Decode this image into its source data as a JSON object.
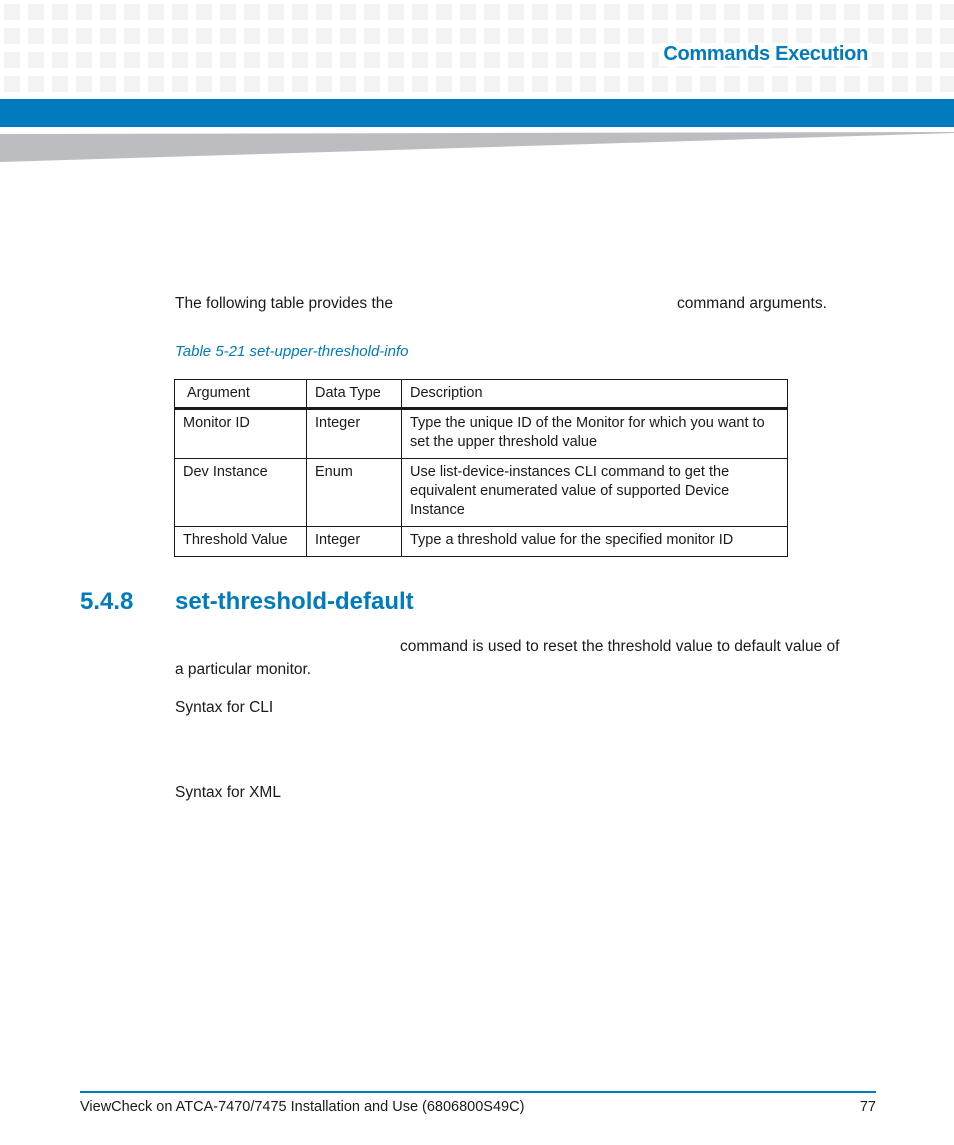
{
  "header": {
    "title": "Commands Execution",
    "accent_color": "#007bbd"
  },
  "intro": {
    "text_before": "The following table provides the",
    "text_after": "command arguments."
  },
  "table": {
    "caption": "Table 5-21 set-upper-threshold-info",
    "columns": [
      "Argument",
      "Data Type",
      "Description"
    ],
    "rows": [
      {
        "argument": "Monitor ID",
        "data_type": "Integer",
        "description": "Type the unique ID of the Monitor for which you want to set the upper threshold value"
      },
      {
        "argument": "Dev Instance",
        "data_type": "Enum",
        "description": "Use list-device-instances CLI command to get the equivalent enumerated value of supported Device Instance"
      },
      {
        "argument": "Threshold Value",
        "data_type": "Integer",
        "description": "Type a threshold value for the specified monitor ID"
      }
    ]
  },
  "section": {
    "number": "5.4.8",
    "title": "set-threshold-default",
    "description_part1": "command is used to reset the threshold value to default value of",
    "description_part2": "a particular monitor.",
    "syntax_cli_label": "Syntax for CLI",
    "syntax_xml_label": "Syntax for XML"
  },
  "footer": {
    "document_title": "ViewCheck on ATCA-7470/7475 Installation and Use (6806800S49C)",
    "page_number": "77"
  }
}
